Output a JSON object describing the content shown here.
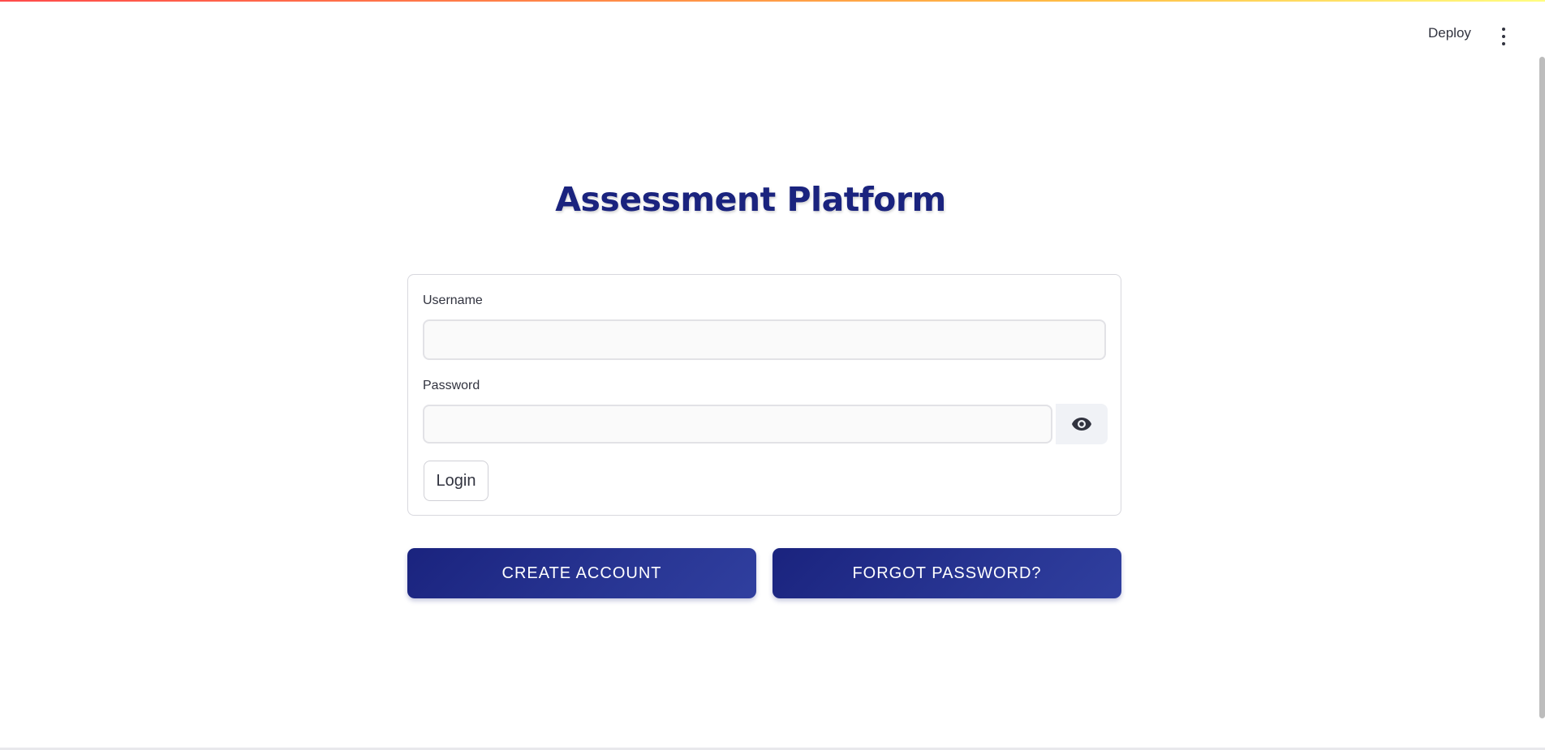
{
  "header": {
    "deploy_label": "Deploy",
    "menu_icon": "kebab-menu-icon",
    "accent_gradient": [
      "#ff4b4b",
      "#ffbd45",
      "#fffd80"
    ]
  },
  "main": {
    "title": "Assessment Platform",
    "title_color": "#1a237e",
    "form": {
      "username_label": "Username",
      "username_value": "",
      "password_label": "Password",
      "password_value": "",
      "password_toggle_icon": "eye-icon",
      "login_label": "Login"
    },
    "actions": {
      "create_account_label": "CREATE ACCOUNT",
      "forgot_password_label": "FORGOT PASSWORD?",
      "button_color": "#1a237e"
    }
  }
}
